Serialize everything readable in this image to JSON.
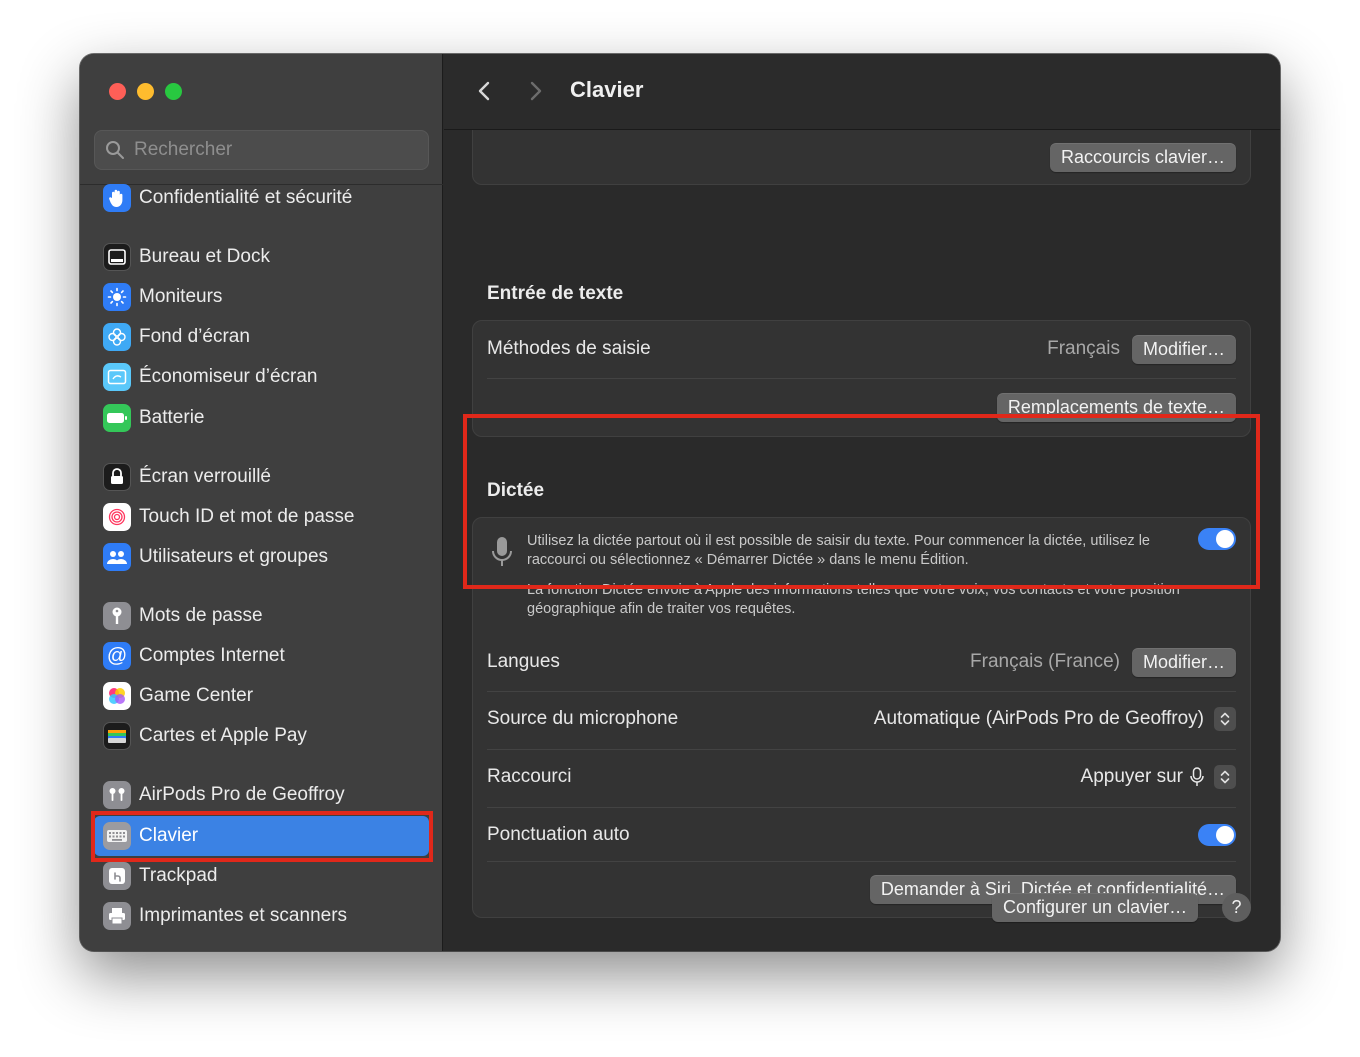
{
  "window": {
    "title": "Clavier",
    "traffic_lights": [
      "close",
      "minimize",
      "zoom"
    ]
  },
  "sidebar": {
    "search_placeholder": "Rechercher",
    "items": [
      {
        "label": "Confidentialité et sécurité",
        "icon": "hand-icon",
        "color": "#2f7cf6"
      },
      {
        "label": "Bureau et Dock",
        "icon": "dock-icon",
        "color": "#1c1c1c"
      },
      {
        "label": "Moniteurs",
        "icon": "sun-icon",
        "color": "#2f7cf6"
      },
      {
        "label": "Fond d’écran",
        "icon": "flower-icon",
        "color": "#3fa9f5"
      },
      {
        "label": "Économiseur d’écran",
        "icon": "screensaver-icon",
        "color": "#5ac8fa"
      },
      {
        "label": "Batterie",
        "icon": "battery-icon",
        "color": "#34c759"
      },
      {
        "label": "Écran verrouillé",
        "icon": "lock-icon",
        "color": "#1c1c1c"
      },
      {
        "label": "Touch ID et mot de passe",
        "icon": "fingerprint-icon",
        "color": "#ffffff"
      },
      {
        "label": "Utilisateurs et groupes",
        "icon": "users-icon",
        "color": "#2f7cf6"
      },
      {
        "label": "Mots de passe",
        "icon": "key-icon",
        "color": "#8e8e93"
      },
      {
        "label": "Comptes Internet",
        "icon": "at-icon",
        "color": "#2f7cf6"
      },
      {
        "label": "Game Center",
        "icon": "game-center-icon",
        "color": "#ffffff"
      },
      {
        "label": "Cartes et Apple Pay",
        "icon": "wallet-icon",
        "color": "#1c1c1c"
      },
      {
        "label": "AirPods Pro de Geoffroy",
        "icon": "airpods-icon",
        "color": "#8e8e93"
      },
      {
        "label": "Clavier",
        "icon": "keyboard-icon",
        "color": "#8e8e93",
        "selected": true
      },
      {
        "label": "Trackpad",
        "icon": "trackpad-icon",
        "color": "#8e8e93"
      },
      {
        "label": "Imprimantes et scanners",
        "icon": "printer-icon",
        "color": "#8e8e93"
      }
    ]
  },
  "toolbar": {
    "back": "back",
    "forward": "forward",
    "title": "Clavier"
  },
  "content": {
    "raccourcis_button": "Raccourcis clavier…",
    "entree_texte": {
      "title": "Entrée de texte",
      "methodes_label": "Méthodes de saisie",
      "methodes_value": "Français",
      "modifier_button": "Modifier…",
      "remplacements_button": "Remplacements de texte…"
    },
    "dictee": {
      "title": "Dictée",
      "description_1": "Utilisez la dictée partout où il est possible de saisir du texte. Pour commencer la dictée, utilisez le raccourci ou sélectionnez « Démarrer Dictée » dans le menu Édition.",
      "description_2": "La fonction Dictée envoie à Apple des informations telles que votre voix, vos contacts et votre position géographique afin de traiter vos requêtes.",
      "enabled": true,
      "langues_label": "Langues",
      "langues_value": "Français (France)",
      "langues_button": "Modifier…",
      "source_label": "Source du microphone",
      "source_value": "Automatique (AirPods Pro de Geoffroy)",
      "raccourci_label": "Raccourci",
      "raccourci_value": "Appuyer sur",
      "ponctuation_label": "Ponctuation auto",
      "ponctuation_enabled": true,
      "siri_button": "Demander à Siri, Dictée et confidentialité…"
    },
    "configurer_button": "Configurer un clavier…",
    "help_label": "?"
  },
  "colors": {
    "accent": "#3b82e4",
    "highlight_frame": "#e0281a",
    "toggle_on": "#3a82f6"
  }
}
